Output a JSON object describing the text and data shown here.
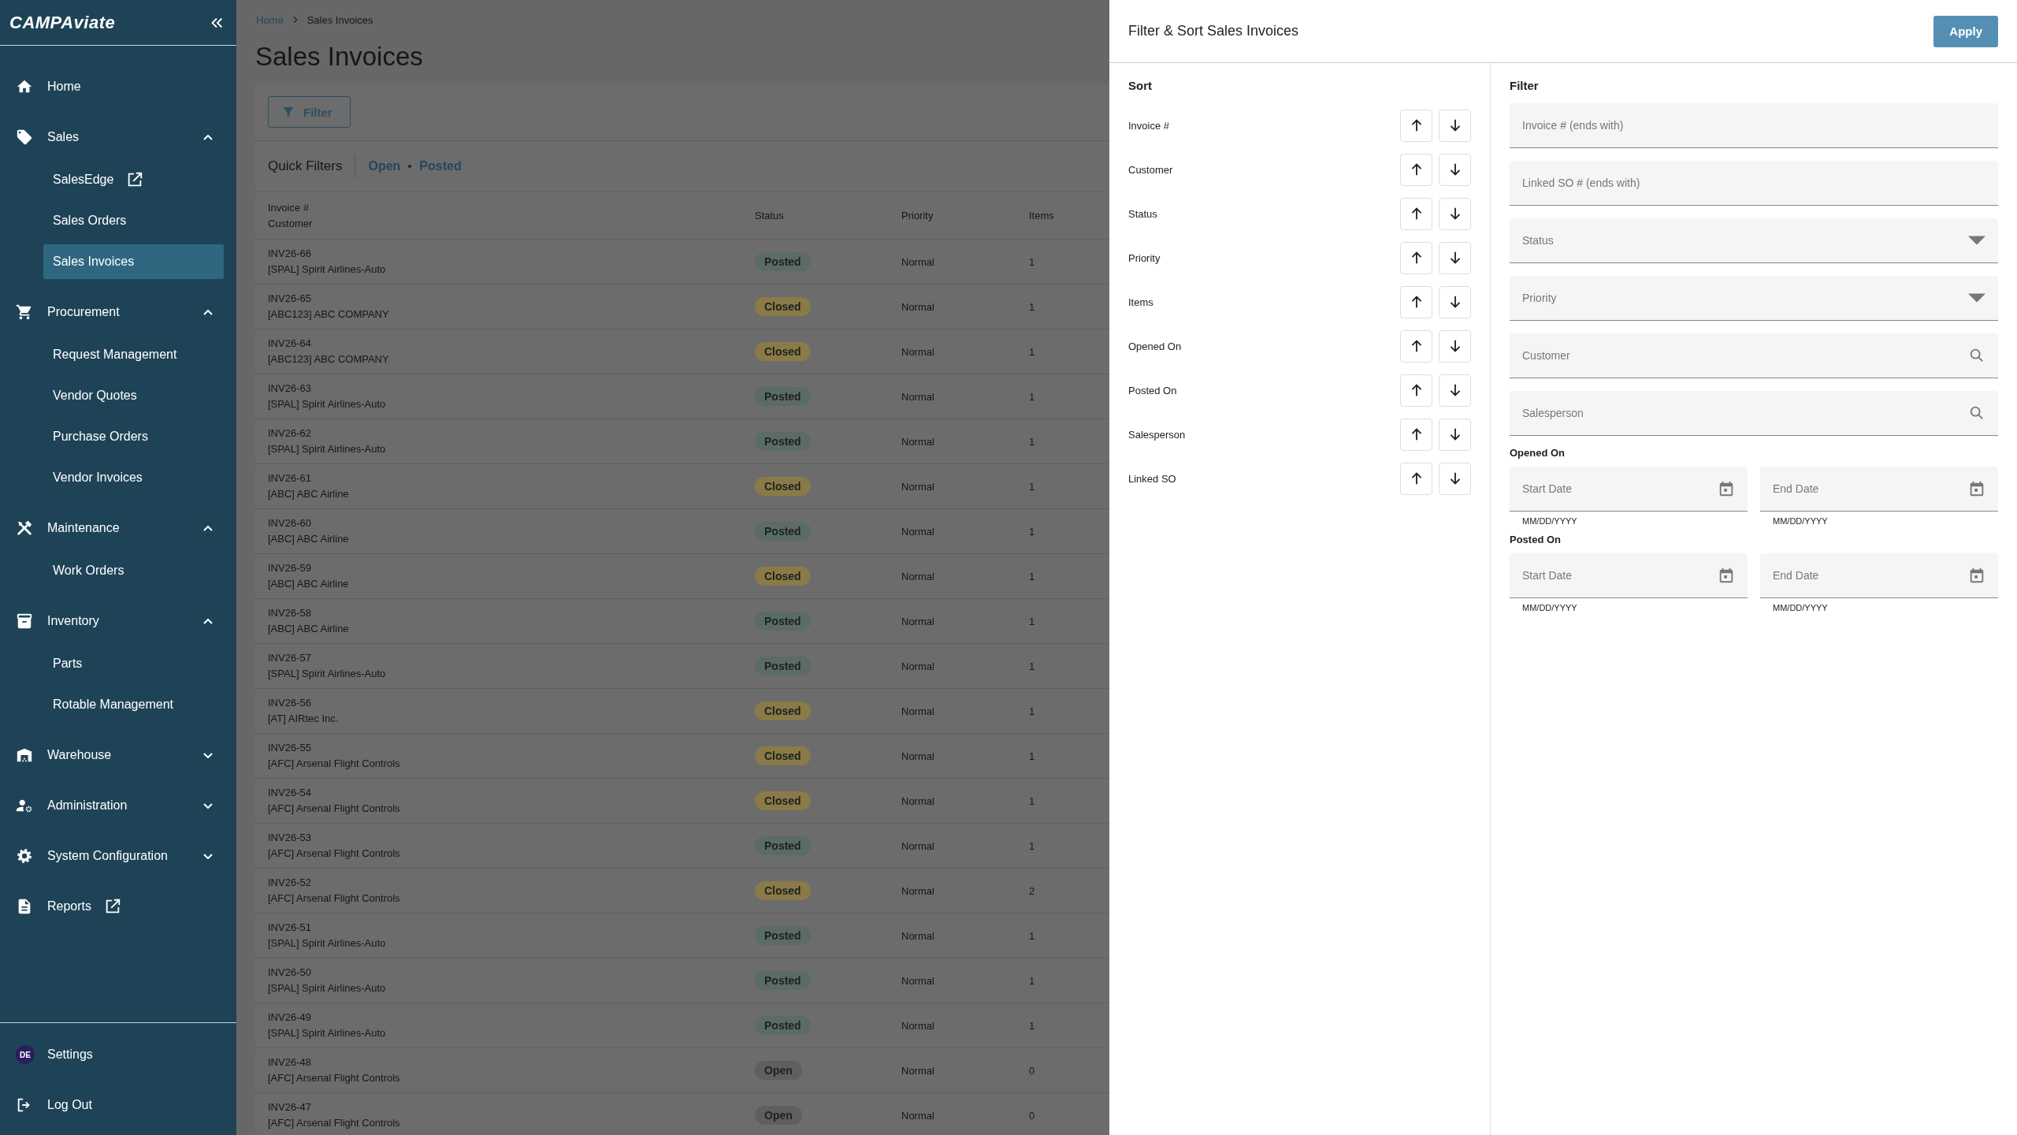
{
  "sidebar": {
    "logo": {
      "part1": "CAMP",
      "part2": "Aviate"
    },
    "items": [
      {
        "label": "Home"
      },
      {
        "label": "Sales",
        "expanded": true,
        "children": [
          {
            "label": "SalesEdge",
            "external": true,
            "selected": false
          },
          {
            "label": "Sales Orders",
            "selected": false
          },
          {
            "label": "Sales Invoices",
            "selected": true
          }
        ]
      },
      {
        "label": "Procurement",
        "expanded": true,
        "children": [
          {
            "label": "Request Management",
            "selected": false
          },
          {
            "label": "Vendor Quotes",
            "selected": false
          },
          {
            "label": "Purchase Orders",
            "selected": false
          },
          {
            "label": "Vendor Invoices",
            "selected": false
          }
        ]
      },
      {
        "label": "Maintenance",
        "expanded": true,
        "children": [
          {
            "label": "Work Orders",
            "selected": false
          }
        ]
      },
      {
        "label": "Inventory",
        "expanded": true,
        "children": [
          {
            "label": "Parts",
            "selected": false
          },
          {
            "label": "Rotable Management",
            "selected": false
          }
        ]
      },
      {
        "label": "Warehouse",
        "expanded": false
      },
      {
        "label": "Administration",
        "expanded": false
      },
      {
        "label": "System Configuration",
        "expanded": false
      },
      {
        "label": "Reports",
        "external": true
      }
    ],
    "footer": {
      "avatar": "DE",
      "settings": "Settings",
      "logout": "Log Out"
    }
  },
  "breadcrumb": [
    "Home",
    "Sales Invoices"
  ],
  "page_title": "Sales Invoices",
  "filter_button": "Filter",
  "quick_filters": {
    "title": "Quick Filters",
    "links": [
      "Open",
      "Posted"
    ]
  },
  "table": {
    "columns": [
      {
        "lines": [
          "Invoice #",
          "Customer"
        ]
      },
      {
        "lines": [
          "Status"
        ]
      },
      {
        "lines": [
          "Priority"
        ]
      },
      {
        "lines": [
          "Items"
        ]
      }
    ],
    "rows": [
      {
        "invoice": "INV26-66",
        "customer": "[SPAL] Spirit Airlines-Auto",
        "status": "Posted",
        "color": "#5b6b67",
        "priority": "Normal",
        "items": "1"
      },
      {
        "invoice": "INV26-65",
        "customer": "[ABC123] ABC COMPANY",
        "status": "Closed",
        "color": "#8a7a47",
        "priority": "Normal",
        "items": "1"
      },
      {
        "invoice": "INV26-64",
        "customer": "[ABC123] ABC COMPANY",
        "status": "Closed",
        "color": "#8a7a47",
        "priority": "Normal",
        "items": "1"
      },
      {
        "invoice": "INV26-63",
        "customer": "[SPAL] Spirit Airlines-Auto",
        "status": "Posted",
        "color": "#5b6b67",
        "priority": "Normal",
        "items": "1"
      },
      {
        "invoice": "INV26-62",
        "customer": "[SPAL] Spirit Airlines-Auto",
        "status": "Posted",
        "color": "#5b6b67",
        "priority": "Normal",
        "items": "1"
      },
      {
        "invoice": "INV26-61",
        "customer": "[ABC] ABC Airline",
        "status": "Closed",
        "color": "#8a7a47",
        "priority": "Normal",
        "items": "1"
      },
      {
        "invoice": "INV26-60",
        "customer": "[ABC] ABC Airline",
        "status": "Posted",
        "color": "#5b6b67",
        "priority": "Normal",
        "items": "1"
      },
      {
        "invoice": "INV26-59",
        "customer": "[ABC] ABC Airline",
        "status": "Closed",
        "color": "#8a7a47",
        "priority": "Normal",
        "items": "1"
      },
      {
        "invoice": "INV26-58",
        "customer": "[ABC] ABC Airline",
        "status": "Posted",
        "color": "#5b6b67",
        "priority": "Normal",
        "items": "1"
      },
      {
        "invoice": "INV26-57",
        "customer": "[SPAL] Spirit Airlines-Auto",
        "status": "Posted",
        "color": "#5b6b67",
        "priority": "Normal",
        "items": "1"
      },
      {
        "invoice": "INV26-56",
        "customer": "[AT] AIRtec Inc.",
        "status": "Closed",
        "color": "#8a7a47",
        "priority": "Normal",
        "items": "1"
      },
      {
        "invoice": "INV26-55",
        "customer": "[AFC] Arsenal Flight Controls",
        "status": "Closed",
        "color": "#8a7a47",
        "priority": "Normal",
        "items": "1"
      },
      {
        "invoice": "INV26-54",
        "customer": "[AFC] Arsenal Flight Controls",
        "status": "Closed",
        "color": "#8a7a47",
        "priority": "Normal",
        "items": "1"
      },
      {
        "invoice": "INV26-53",
        "customer": "[AFC] Arsenal Flight Controls",
        "status": "Posted",
        "color": "#5b6b67",
        "priority": "Normal",
        "items": "1"
      },
      {
        "invoice": "INV26-52",
        "customer": "[AFC] Arsenal Flight Controls",
        "status": "Closed",
        "color": "#8a7a47",
        "priority": "Normal",
        "items": "2"
      },
      {
        "invoice": "INV26-51",
        "customer": "[SPAL] Spirit Airlines-Auto",
        "status": "Posted",
        "color": "#5b6b67",
        "priority": "Normal",
        "items": "1"
      },
      {
        "invoice": "INV26-50",
        "customer": "[SPAL] Spirit Airlines-Auto",
        "status": "Posted",
        "color": "#5b6b67",
        "priority": "Normal",
        "items": "1"
      },
      {
        "invoice": "INV26-49",
        "customer": "[SPAL] Spirit Airlines-Auto",
        "status": "Posted",
        "color": "#5b6b67",
        "priority": "Normal",
        "items": "1"
      },
      {
        "invoice": "INV26-48",
        "customer": "[AFC] Arsenal Flight Controls",
        "status": "Open",
        "color": "#5f5f5f",
        "priority": "Normal",
        "items": "0"
      },
      {
        "invoice": "INV26-47",
        "customer": "[AFC] Arsenal Flight Controls",
        "status": "Open",
        "color": "#5f5f5f",
        "priority": "Normal",
        "items": "0"
      }
    ]
  },
  "panel": {
    "title": "Filter & Sort Sales Invoices",
    "apply": "Apply",
    "sort": {
      "title": "Sort",
      "fields": [
        "Invoice #",
        "Customer",
        "Status",
        "Priority",
        "Items",
        "Opened On",
        "Posted On",
        "Salesperson",
        "Linked SO"
      ]
    },
    "filter": {
      "title": "Filter",
      "fields": [
        {
          "kind": "text",
          "placeholder": "Invoice # (ends with)"
        },
        {
          "kind": "text",
          "placeholder": "Linked SO # (ends with)"
        },
        {
          "kind": "select",
          "placeholder": "Status"
        },
        {
          "kind": "select",
          "placeholder": "Priority"
        },
        {
          "kind": "search",
          "placeholder": "Customer"
        },
        {
          "kind": "search",
          "placeholder": "Salesperson"
        }
      ],
      "date_groups": [
        {
          "label": "Opened On",
          "fields": [
            {
              "placeholder": "Start Date",
              "helper": "MM/DD/YYYY"
            },
            {
              "placeholder": "End Date",
              "helper": "MM/DD/YYYY"
            }
          ]
        },
        {
          "label": "Posted On",
          "fields": [
            {
              "placeholder": "Start Date",
              "helper": "MM/DD/YYYY"
            },
            {
              "placeholder": "End Date",
              "helper": "MM/DD/YYYY"
            }
          ]
        }
      ]
    }
  }
}
